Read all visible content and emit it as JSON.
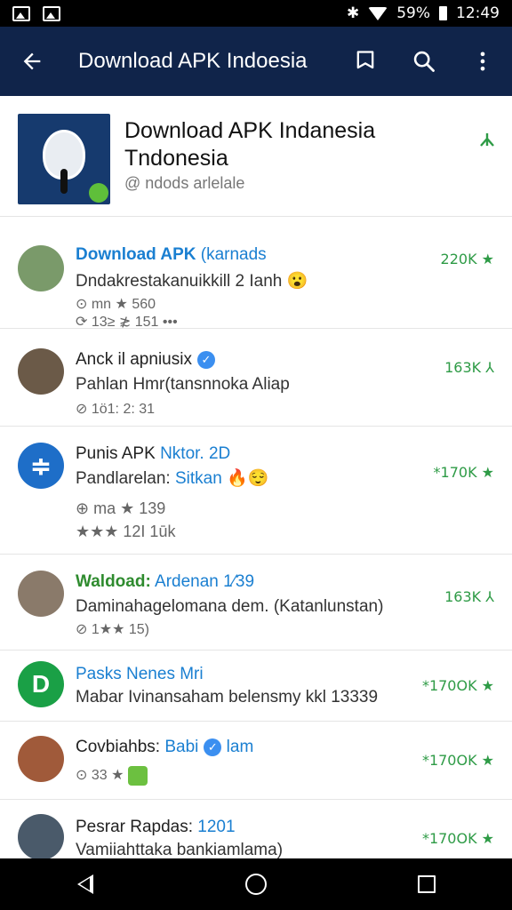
{
  "status_bar": {
    "battery": "59%",
    "time": "12:49"
  },
  "app_bar": {
    "title": "Download APK  Indoesia"
  },
  "header": {
    "title_line1": "Download APK Indanesia",
    "title_line2": "Tndonesia",
    "subtitle": "@ ndods arlelale"
  },
  "rows": [
    {
      "name": "Download APK",
      "name_suffix": "(karnads",
      "desc": "Dndakrestakanuikkill 2 Ianh",
      "emoji": "😮",
      "meta": "⊙ mn ★ 560",
      "meta2": "⟳ 13≥ ≵ 151    •••",
      "count": "220K"
    },
    {
      "name": "Anck il apniusix",
      "desc": "Pahlan Hmr(tansnnoka Aliap",
      "meta": "⊘ 1ö1: 2: 31",
      "count": "163K"
    },
    {
      "name": "Punis APK",
      "name_suffix": "Nktor. 2D",
      "desc_a": "Pandlarelan:",
      "desc_b": "Sitkan",
      "emoji": "🔥😌",
      "meta": "⊕ ma ★ 139",
      "meta2": "★★★ 12I   1ūk",
      "count": "*170K ★"
    },
    {
      "name": "Waldoad:",
      "name_suffix": "Ardenan 1⁄39",
      "desc": "Daminahagelomana dem. (Katanlunstan)",
      "meta": "⊘ 1★★ 15)",
      "count": "163K"
    },
    {
      "name": "Pasks Nenes Mri",
      "desc": "Mabar Ivinansaham belensmy kkl 13339",
      "count": "*170OK ★"
    },
    {
      "name": "Covbiahbs:",
      "name_suffix": "Babi",
      "name_suffix2": "lam",
      "meta": "⊙ 33 ★",
      "count": "*170OK ★"
    },
    {
      "name": "Pesrar Rapdas:",
      "name_suffix": "1201",
      "desc": "Vamiiahttaka bankiamlama)",
      "count": "*170OK ★"
    }
  ],
  "icons": {
    "back": "arrow-left-icon",
    "bookmark": "bookmark-icon",
    "search": "search-icon",
    "more": "more-vertical-icon"
  },
  "colors": {
    "app_bar": "#10244a",
    "accent_blue": "#1a7fd1",
    "accent_green": "#2e9b46"
  }
}
